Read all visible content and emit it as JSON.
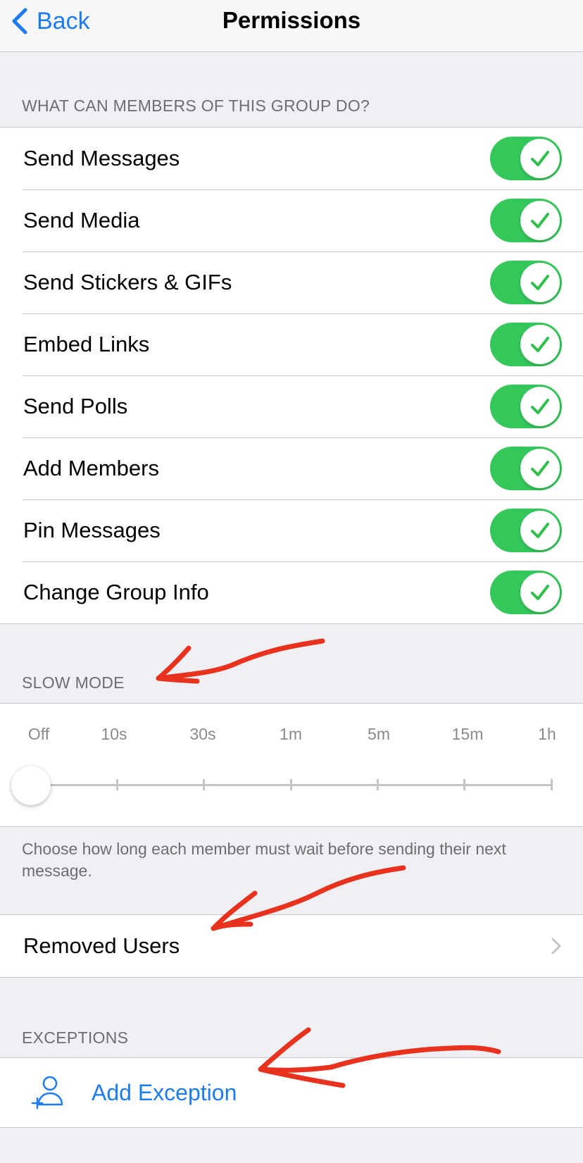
{
  "navbar": {
    "back_label": "Back",
    "title": "Permissions"
  },
  "permissions": {
    "header": "WHAT CAN MEMBERS OF THIS GROUP DO?",
    "items": [
      {
        "label": "Send Messages",
        "enabled": true
      },
      {
        "label": "Send Media",
        "enabled": true
      },
      {
        "label": "Send Stickers & GIFs",
        "enabled": true
      },
      {
        "label": "Embed Links",
        "enabled": true
      },
      {
        "label": "Send Polls",
        "enabled": true
      },
      {
        "label": "Add Members",
        "enabled": true
      },
      {
        "label": "Pin Messages",
        "enabled": true
      },
      {
        "label": "Change Group Info",
        "enabled": true
      }
    ]
  },
  "slow_mode": {
    "header": "SLOW MODE",
    "options": [
      "Off",
      "10s",
      "30s",
      "1m",
      "5m",
      "15m",
      "1h"
    ],
    "selected": "Off",
    "footer": "Choose how long each member must wait before sending their next message."
  },
  "removed_users": {
    "label": "Removed Users"
  },
  "exceptions": {
    "header": "EXCEPTIONS",
    "add_label": "Add Exception"
  },
  "colors": {
    "accent": "#1d7cf2",
    "toggle_on": "#34c759",
    "background": "#efeff4",
    "annotation": "#e8321e"
  }
}
